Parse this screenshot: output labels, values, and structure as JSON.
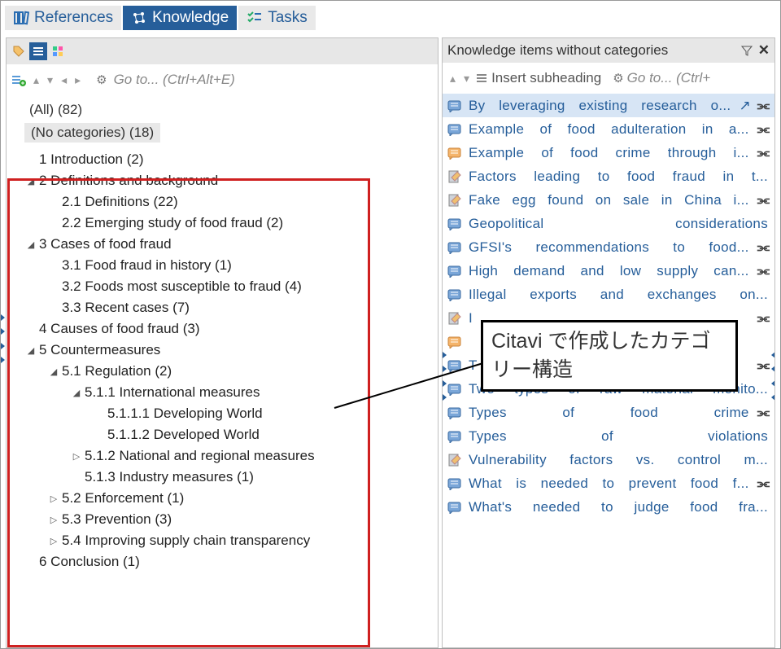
{
  "tabs": {
    "references": "References",
    "knowledge": "Knowledge",
    "tasks": "Tasks"
  },
  "left": {
    "goto_placeholder": "Go to... (Ctrl+Alt+E)",
    "all": "(All) (82)",
    "nocat": "(No categories) (18)"
  },
  "tree": [
    {
      "d": 0,
      "tw": "",
      "t": "1 Introduction (2)"
    },
    {
      "d": 0,
      "tw": "▲",
      "t": "2 Definitions and background"
    },
    {
      "d": 1,
      "tw": "",
      "t": "2.1 Definitions (22)"
    },
    {
      "d": 1,
      "tw": "",
      "t": "2.2 Emerging study of food fraud (2)"
    },
    {
      "d": 0,
      "tw": "▲",
      "t": "3 Cases of food fraud"
    },
    {
      "d": 1,
      "tw": "",
      "t": "3.1 Food fraud in history (1)"
    },
    {
      "d": 1,
      "tw": "",
      "t": "3.2 Foods most susceptible to fraud (4)"
    },
    {
      "d": 1,
      "tw": "",
      "t": "3.3 Recent cases (7)"
    },
    {
      "d": 0,
      "tw": "",
      "t": "4 Causes of food fraud (3)"
    },
    {
      "d": 0,
      "tw": "▲",
      "t": "5 Countermeasures"
    },
    {
      "d": 1,
      "tw": "▲",
      "t": "5.1 Regulation (2)"
    },
    {
      "d": 2,
      "tw": "▲",
      "t": "5.1.1 International measures"
    },
    {
      "d": 3,
      "tw": "",
      "t": "5.1.1.1 Developing World"
    },
    {
      "d": 3,
      "tw": "",
      "t": "5.1.1.2 Developed World"
    },
    {
      "d": 2,
      "tw": "▷",
      "t": "5.1.2 National and regional measures"
    },
    {
      "d": 2,
      "tw": "",
      "t": "5.1.3 Industry measures (1)"
    },
    {
      "d": 1,
      "tw": "▷",
      "t": "5.2 Enforcement (1)"
    },
    {
      "d": 1,
      "tw": "▷",
      "t": "5.3 Prevention (3)"
    },
    {
      "d": 1,
      "tw": "▷",
      "t": "5.4 Improving supply chain transparency"
    },
    {
      "d": 0,
      "tw": "",
      "t": "6 Conclusion (1)"
    }
  ],
  "right": {
    "title": "Knowledge items without categories",
    "insert": "Insert subheading",
    "goto": "Go to... (Ctrl+",
    "open_glyph": "↗",
    "link_glyph": "⫘"
  },
  "items": [
    {
      "k": "blue",
      "t": "By leveraging existing research o...",
      "sel": true,
      "open": true,
      "link": true
    },
    {
      "k": "blue",
      "t": "Example of food adulteration in a...",
      "link": true
    },
    {
      "k": "orange",
      "t": "Example of food crime through i...",
      "link": true
    },
    {
      "k": "pencil",
      "t": "Factors leading to food fraud in t..."
    },
    {
      "k": "pencil",
      "t": "Fake egg found on sale in China i...",
      "link": true
    },
    {
      "k": "blue",
      "t": "Geopolitical considerations"
    },
    {
      "k": "blue",
      "t": "GFSI's recommendations to food...",
      "link": true
    },
    {
      "k": "blue",
      "t": "High demand and low supply can...",
      "link": true
    },
    {
      "k": "blue",
      "t": "Illegal exports and exchanges on..."
    },
    {
      "k": "pencil",
      "t": "I",
      "link": true
    },
    {
      "k": "orange",
      "t": ""
    },
    {
      "k": "blue",
      "t": "T",
      "link": true
    },
    {
      "k": "blue",
      "t": "Two types of raw material monito..."
    },
    {
      "k": "blue",
      "t": "Types of food crime",
      "link": true
    },
    {
      "k": "blue",
      "t": "Types of violations"
    },
    {
      "k": "pencil",
      "t": "Vulnerability factors vs. control m..."
    },
    {
      "k": "blue",
      "t": "What is needed to prevent food f...",
      "link": true
    },
    {
      "k": "blue",
      "t": "What's needed to judge food fra..."
    }
  ],
  "callout": "Citavi で作成したカテゴリー構造"
}
